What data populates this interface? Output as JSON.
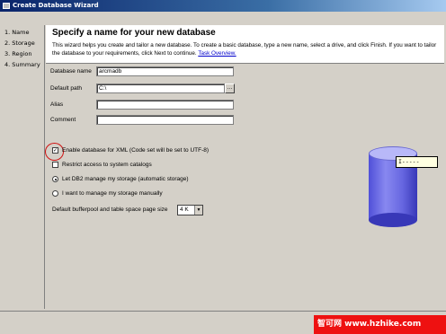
{
  "window": {
    "title": "Create Database Wizard"
  },
  "sidebar": {
    "items": [
      {
        "label": "1. Name"
      },
      {
        "label": "2. Storage"
      },
      {
        "label": "3. Region"
      },
      {
        "label": "4. Summary"
      }
    ]
  },
  "header": {
    "title": "Specify a name for your new database",
    "description": "This wizard helps you create and tailor a new database. To create a basic database, type a new name, select a drive, and click Finish. If you want to tailor the database to your requirements, click Next to continue.",
    "link": "Task Overview."
  },
  "form": {
    "database_name_label": "Database name",
    "database_name_value": "arcmadb",
    "default_path_label": "Default path",
    "default_path_value": "C:\\",
    "browse_label": "...",
    "alias_label": "Alias",
    "alias_value": "",
    "comment_label": "Comment",
    "comment_value": ""
  },
  "options": {
    "xml_label": "Enable database for XML (Code set will be set to UTF-8)",
    "xml_checked": true,
    "restrict_label": "Restrict access to system catalogs",
    "restrict_checked": false,
    "auto_storage_label": "Let DB2 manage my storage (automatic storage)",
    "auto_storage_selected": true,
    "manual_storage_label": "I want to manage my storage manually",
    "manual_storage_selected": false,
    "pagesize_label": "Default bufferpool and table space page size",
    "pagesize_value": "4 K"
  },
  "tooltip": {
    "text": "I-----"
  },
  "watermark": {
    "text": "智可网 www.hzhike.com"
  },
  "colors": {
    "annotation_circle": "#d01010",
    "cylinder": "#6666e0",
    "watermark_bg": "#ee1111"
  }
}
